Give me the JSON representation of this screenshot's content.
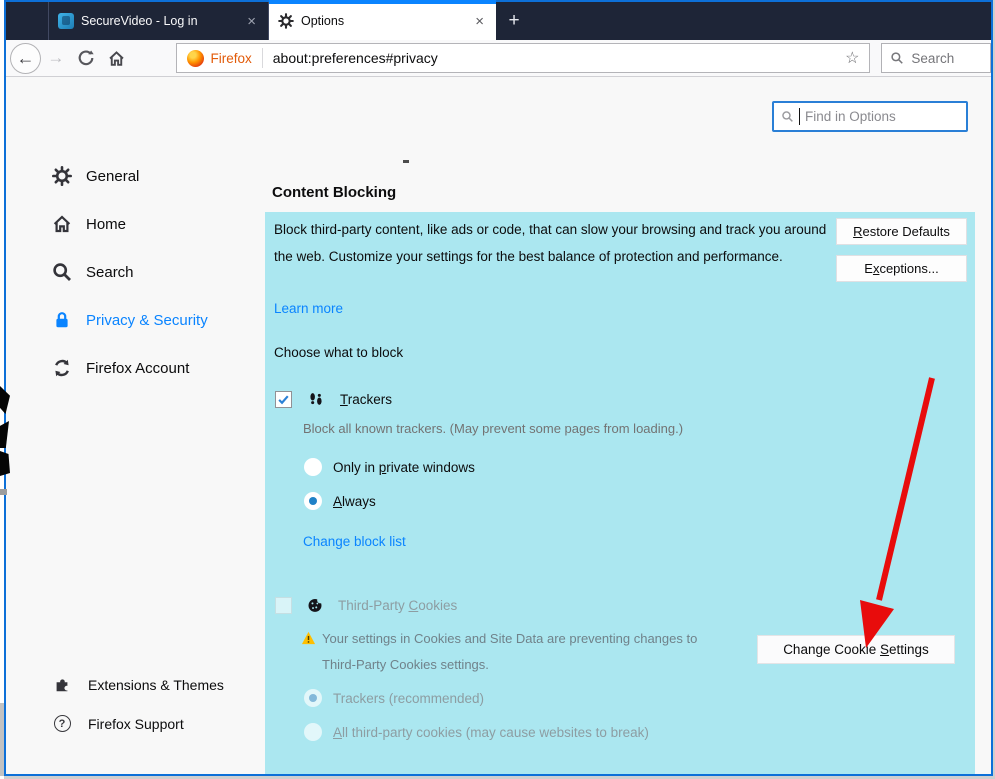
{
  "tabbar": {
    "tabs": [
      {
        "title": "SecureVideo - Log in",
        "close_glyph": "×"
      },
      {
        "title": "Options",
        "close_glyph": "×"
      }
    ],
    "new_tab_glyph": "+"
  },
  "toolbar": {
    "back_glyph": "←",
    "forward_glyph": "→",
    "urlbar": {
      "chip_label": "Firefox",
      "url": "about:preferences#privacy",
      "star_glyph": "☆"
    },
    "search": {
      "placeholder": "Search"
    }
  },
  "find_in_options": {
    "placeholder": "Find in Options"
  },
  "sidebar": {
    "items": [
      {
        "label": "General"
      },
      {
        "label": "Home"
      },
      {
        "label": "Search"
      },
      {
        "label": "Privacy & Security",
        "selected": true
      },
      {
        "label": "Firefox Account"
      }
    ],
    "footer_items": [
      {
        "label": "Extensions & Themes"
      },
      {
        "label": "Firefox Support",
        "glyph": "?"
      }
    ]
  },
  "content": {
    "heading": "Content Blocking",
    "panel": {
      "description": "Block third-party content, like ads or code, that can slow your browsing and track you around the web. Customize your settings for the best balance of protection and performance.",
      "learn_more_label": "Learn more",
      "restore_defaults": {
        "pre": "",
        "key": "R",
        "post": "estore Defaults"
      },
      "exceptions": {
        "pre": "E",
        "key": "x",
        "post": "ceptions..."
      },
      "choose_label": "Choose what to block",
      "trackers": {
        "label": {
          "pre": "",
          "key": "T",
          "post": "rackers"
        },
        "description": "Block all known trackers. (May prevent some pages from loading.)",
        "radio_private": {
          "pre": "Only in ",
          "key": "p",
          "post": "rivate windows"
        },
        "radio_always": {
          "pre": "",
          "key": "A",
          "post": "lways"
        },
        "change_block_list_label": "Change block list"
      },
      "third_party_cookies": {
        "label": {
          "pre": "Third-Party ",
          "key": "C",
          "post": "ookies"
        },
        "warning_line1": "Your settings in Cookies and Site Data are preventing changes to",
        "warning_line2": "Third-Party Cookies settings.",
        "change_cookie_settings": {
          "pre": "Change Cookie ",
          "key": "S",
          "post": "ettings"
        },
        "radio_trackers": {
          "pre": "",
          "key": "",
          "post": "Trackers (recommended)"
        },
        "radio_all": {
          "pre": "",
          "key": "A",
          "post": "ll third-party cookies (may cause websites to break)"
        }
      }
    }
  },
  "colors": {
    "accent_blue": "#0a84ff",
    "highlight_cyan": "#abe7f0",
    "arrow_red": "#e80c0c",
    "tabbar_navy": "#1e2537"
  }
}
